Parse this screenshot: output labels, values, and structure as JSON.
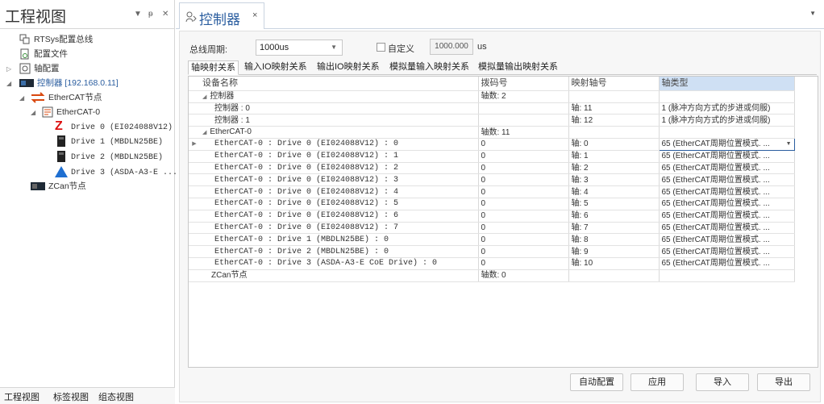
{
  "left_panel": {
    "title": "工程视图",
    "pin_icon": "pin-icon",
    "tree": {
      "bus_config": "RTSys配置总线",
      "config_file": "配置文件",
      "axis_config": "轴配置",
      "controller": "控制器 [192.168.0.11]",
      "ethercat_node": "EtherCAT节点",
      "ethercat_0": "EtherCAT-0",
      "drives": [
        "Drive 0 (EI024088V12)",
        "Drive 1 (MBDLN25BE)",
        "Drive 2 (MBDLN25BE)",
        "Drive 3 (ASDA-A3-E ..."
      ],
      "zcan_node": "ZCan节点"
    },
    "bottom_tabs": [
      "工程视图",
      "标签视图",
      "组态视图"
    ]
  },
  "doc_tab": {
    "title": "控制器",
    "close": "×"
  },
  "toolbar": {
    "cycle_label": "总线周期:",
    "cycle_value": "1000us",
    "custom_label": "自定义",
    "custom_value": "1000.000",
    "unit": "us"
  },
  "sub_tabs": [
    "轴映射关系",
    "输入IO映射关系",
    "输出IO映射关系",
    "模拟量输入映射关系",
    "模拟量输出映射关系"
  ],
  "grid": {
    "columns": [
      "设备名称",
      "拨码号",
      "映射轴号",
      "轴类型"
    ],
    "rows": [
      {
        "name": "控制器",
        "code": "轴数: 2",
        "axis": "",
        "type": "",
        "level": "group",
        "expander": "◢"
      },
      {
        "name": "控制器 : 0",
        "code": "",
        "axis": "轴: 11",
        "type": "1 (脉冲方向方式的步进或伺服)",
        "level": "child"
      },
      {
        "name": "控制器 : 1",
        "code": "",
        "axis": "轴: 12",
        "type": "1 (脉冲方向方式的步进或伺服)",
        "level": "child"
      },
      {
        "name": "EtherCAT-0",
        "code": "轴数: 11",
        "axis": "",
        "type": "",
        "level": "group",
        "expander": "◢"
      },
      {
        "name": "EtherCAT-0 : Drive 0 (EI024088V12) : 0",
        "code": "0",
        "axis": "轴: 0",
        "type": "65 (EtherCAT周期位置模式. ...",
        "level": "child",
        "current": true
      },
      {
        "name": "EtherCAT-0 : Drive 0 (EI024088V12) : 1",
        "code": "0",
        "axis": "轴: 1",
        "type": "65 (EtherCAT周期位置模式. ...",
        "level": "child"
      },
      {
        "name": "EtherCAT-0 : Drive 0 (EI024088V12) : 2",
        "code": "0",
        "axis": "轴: 2",
        "type": "65 (EtherCAT周期位置模式. ...",
        "level": "child"
      },
      {
        "name": "EtherCAT-0 : Drive 0 (EI024088V12) : 3",
        "code": "0",
        "axis": "轴: 3",
        "type": "65 (EtherCAT周期位置模式. ...",
        "level": "child"
      },
      {
        "name": "EtherCAT-0 : Drive 0 (EI024088V12) : 4",
        "code": "0",
        "axis": "轴: 4",
        "type": "65 (EtherCAT周期位置模式. ...",
        "level": "child"
      },
      {
        "name": "EtherCAT-0 : Drive 0 (EI024088V12) : 5",
        "code": "0",
        "axis": "轴: 5",
        "type": "65 (EtherCAT周期位置模式. ...",
        "level": "child"
      },
      {
        "name": "EtherCAT-0 : Drive 0 (EI024088V12) : 6",
        "code": "0",
        "axis": "轴: 6",
        "type": "65 (EtherCAT周期位置模式. ...",
        "level": "child"
      },
      {
        "name": "EtherCAT-0 : Drive 0 (EI024088V12) : 7",
        "code": "0",
        "axis": "轴: 7",
        "type": "65 (EtherCAT周期位置模式. ...",
        "level": "child"
      },
      {
        "name": "EtherCAT-0 : Drive 1 (MBDLN25BE) : 0",
        "code": "0",
        "axis": "轴: 8",
        "type": "65 (EtherCAT周期位置模式. ...",
        "level": "child"
      },
      {
        "name": "EtherCAT-0 : Drive 2 (MBDLN25BE) : 0",
        "code": "0",
        "axis": "轴: 9",
        "type": "65 (EtherCAT周期位置模式. ...",
        "level": "child"
      },
      {
        "name": "EtherCAT-0 : Drive 3 (ASDA-A3-E CoE Drive) : 0",
        "code": "0",
        "axis": "轴: 10",
        "type": "65 (EtherCAT周期位置模式. ...",
        "level": "child"
      },
      {
        "name": "ZCan节点",
        "code": "轴数: 0",
        "axis": "",
        "type": "",
        "level": "group",
        "expander": ""
      }
    ]
  },
  "buttons": {
    "auto_config": "自动配置",
    "apply": "应用",
    "import": "导入",
    "export": "导出"
  },
  "colors": {
    "accent": "#2a5d9f",
    "header_selected": "#cfe0f4",
    "panel_bg": "#f7f7f7"
  }
}
